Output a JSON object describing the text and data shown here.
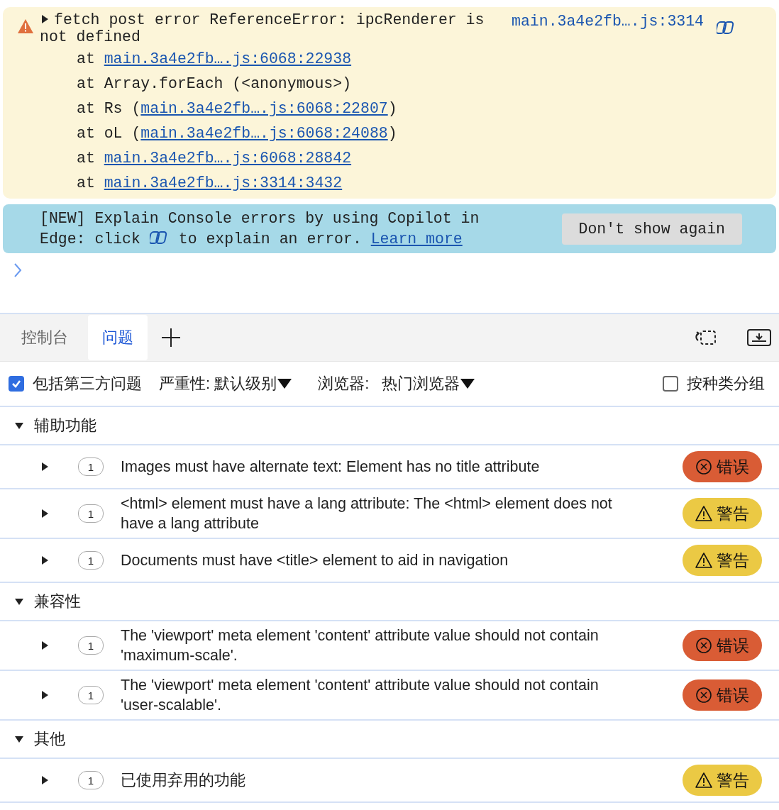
{
  "console": {
    "error": {
      "expanded": false,
      "message": "fetch post error ReferenceError: ipcRenderer is not defined",
      "source": "main.3a4e2fb….js:3314",
      "stack": [
        {
          "prefix": "at ",
          "link": "main.3a4e2fb….js:6068:22938"
        },
        {
          "prefix": "at Array.forEach (<anonymous>)"
        },
        {
          "prefix": "at Rs (",
          "link": "main.3a4e2fb….js:6068:22807",
          "suffix": ")"
        },
        {
          "prefix": "at oL (",
          "link": "main.3a4e2fb….js:6068:24088",
          "suffix": ")"
        },
        {
          "prefix": "at ",
          "link": "main.3a4e2fb….js:6068:28842"
        },
        {
          "prefix": "at ",
          "link": "main.3a4e2fb….js:3314:3432"
        }
      ]
    },
    "banner": {
      "before": "[NEW] Explain Console errors by using Copilot in Edge: click",
      "after": "to explain an error.",
      "link": "Learn more",
      "button": "Don't show again"
    }
  },
  "drawer": {
    "tabs": [
      {
        "label": "控制台",
        "selected": false
      },
      {
        "label": "问题",
        "selected": true
      }
    ]
  },
  "toolbar": {
    "third_party": {
      "label": "包括第三方问题",
      "checked": true
    },
    "severity": "严重性: 默认级别",
    "browser_label": "浏览器:",
    "browser_value": "热门浏览器",
    "group_by_kind": {
      "label": "按种类分组",
      "checked": false
    }
  },
  "groups": [
    {
      "title": "辅助功能",
      "expanded": true,
      "issues": [
        {
          "expanded": false,
          "count": "1",
          "text": "Images must have alternate text: Element has no title attribute",
          "kind": "error",
          "badge": "错误"
        },
        {
          "expanded": false,
          "count": "1",
          "text": "<html> element must have a lang attribute: The <html> element does not have a lang attribute",
          "kind": "warning",
          "badge": "警告"
        },
        {
          "expanded": false,
          "count": "1",
          "text": "Documents must have <title> element to aid in navigation",
          "kind": "warning",
          "badge": "警告"
        }
      ]
    },
    {
      "title": "兼容性",
      "expanded": true,
      "issues": [
        {
          "expanded": false,
          "count": "1",
          "text": "The 'viewport' meta element 'content' attribute value should not contain 'maximum-scale'.",
          "kind": "error",
          "badge": "错误"
        },
        {
          "expanded": false,
          "count": "1",
          "text": "The 'viewport' meta element 'content' attribute value should not contain 'user-scalable'.",
          "kind": "error",
          "badge": "错误"
        }
      ]
    },
    {
      "title": "其他",
      "expanded": true,
      "issues": [
        {
          "expanded": false,
          "count": "1",
          "text": "已使用弃用的功能",
          "kind": "warning",
          "badge": "警告"
        }
      ]
    }
  ]
}
